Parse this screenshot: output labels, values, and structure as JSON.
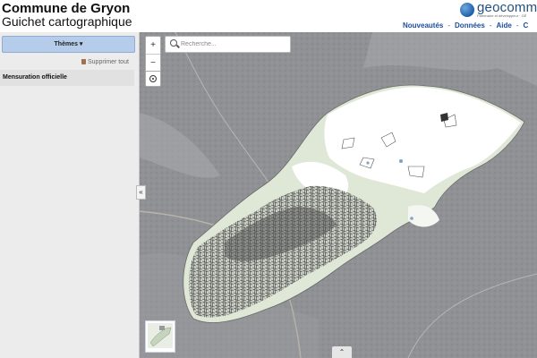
{
  "header": {
    "title": "Commune de Gryon",
    "subtitle": "Guichet cartographique",
    "logo_text": "geocomm",
    "logo_tagline": "Partenaire et développeur · GÉ",
    "nav": [
      "Nouveautés",
      "Données",
      "Aide",
      "C"
    ]
  },
  "panel": {
    "themes_label": "Thèmes ▾",
    "delete_all_label": "Supprimer tout",
    "layers": [
      "Mensuration officielle"
    ],
    "collapse_label": "«"
  },
  "map": {
    "search_placeholder": "Recherche...",
    "zoom_in": "+",
    "zoom_out": "−",
    "expand_label": "⌃"
  },
  "colors": {
    "accent": "#1a4fa0",
    "themes_button": "#b5cdea",
    "map_background": "#8e9094",
    "commune_fill": "#dfe8d6"
  },
  "icons": [
    "trash-icon",
    "search-icon",
    "locate-icon",
    "chevron-left-double-icon",
    "chevron-up-double-icon",
    "geocomm-logo-icon"
  ]
}
